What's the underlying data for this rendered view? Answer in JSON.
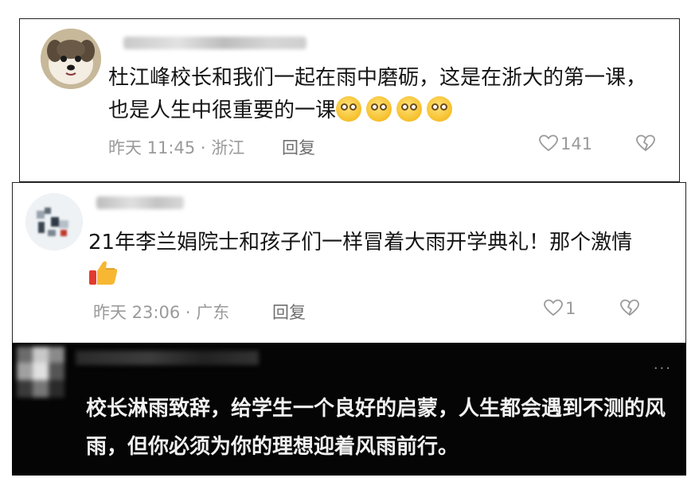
{
  "comments": [
    {
      "text": "杜江峰校长和我们一起在雨中磨砺，这是在浙大的第一课，也是人生中很重要的一课",
      "emoji_count": 4,
      "time_location": "昨天 11:45 · 浙江",
      "reply_label": "回复",
      "likes": "141",
      "like_icon": "heart-outline-icon",
      "dislike_icon": "broken-heart-icon"
    },
    {
      "text": "21年李兰娟院士和孩子们一样冒着大雨开学典礼！那个激情",
      "emoji": "thumbs-up",
      "time_location": "昨天 23:06 · 广东",
      "reply_label": "回复",
      "likes": "1",
      "like_icon": "heart-outline-icon",
      "dislike_icon": "broken-heart-icon"
    },
    {
      "text": "校长淋雨致辞，给学生一个良好的启蒙，人生都会遇到不测的风雨，但你必须为你的理想迎着风雨前行。",
      "more_label": "···"
    }
  ],
  "colors": {
    "meta": "#9a9a9a",
    "text": "#151515",
    "dark_bg": "#050505",
    "dark_text": "#f2f2f2"
  }
}
